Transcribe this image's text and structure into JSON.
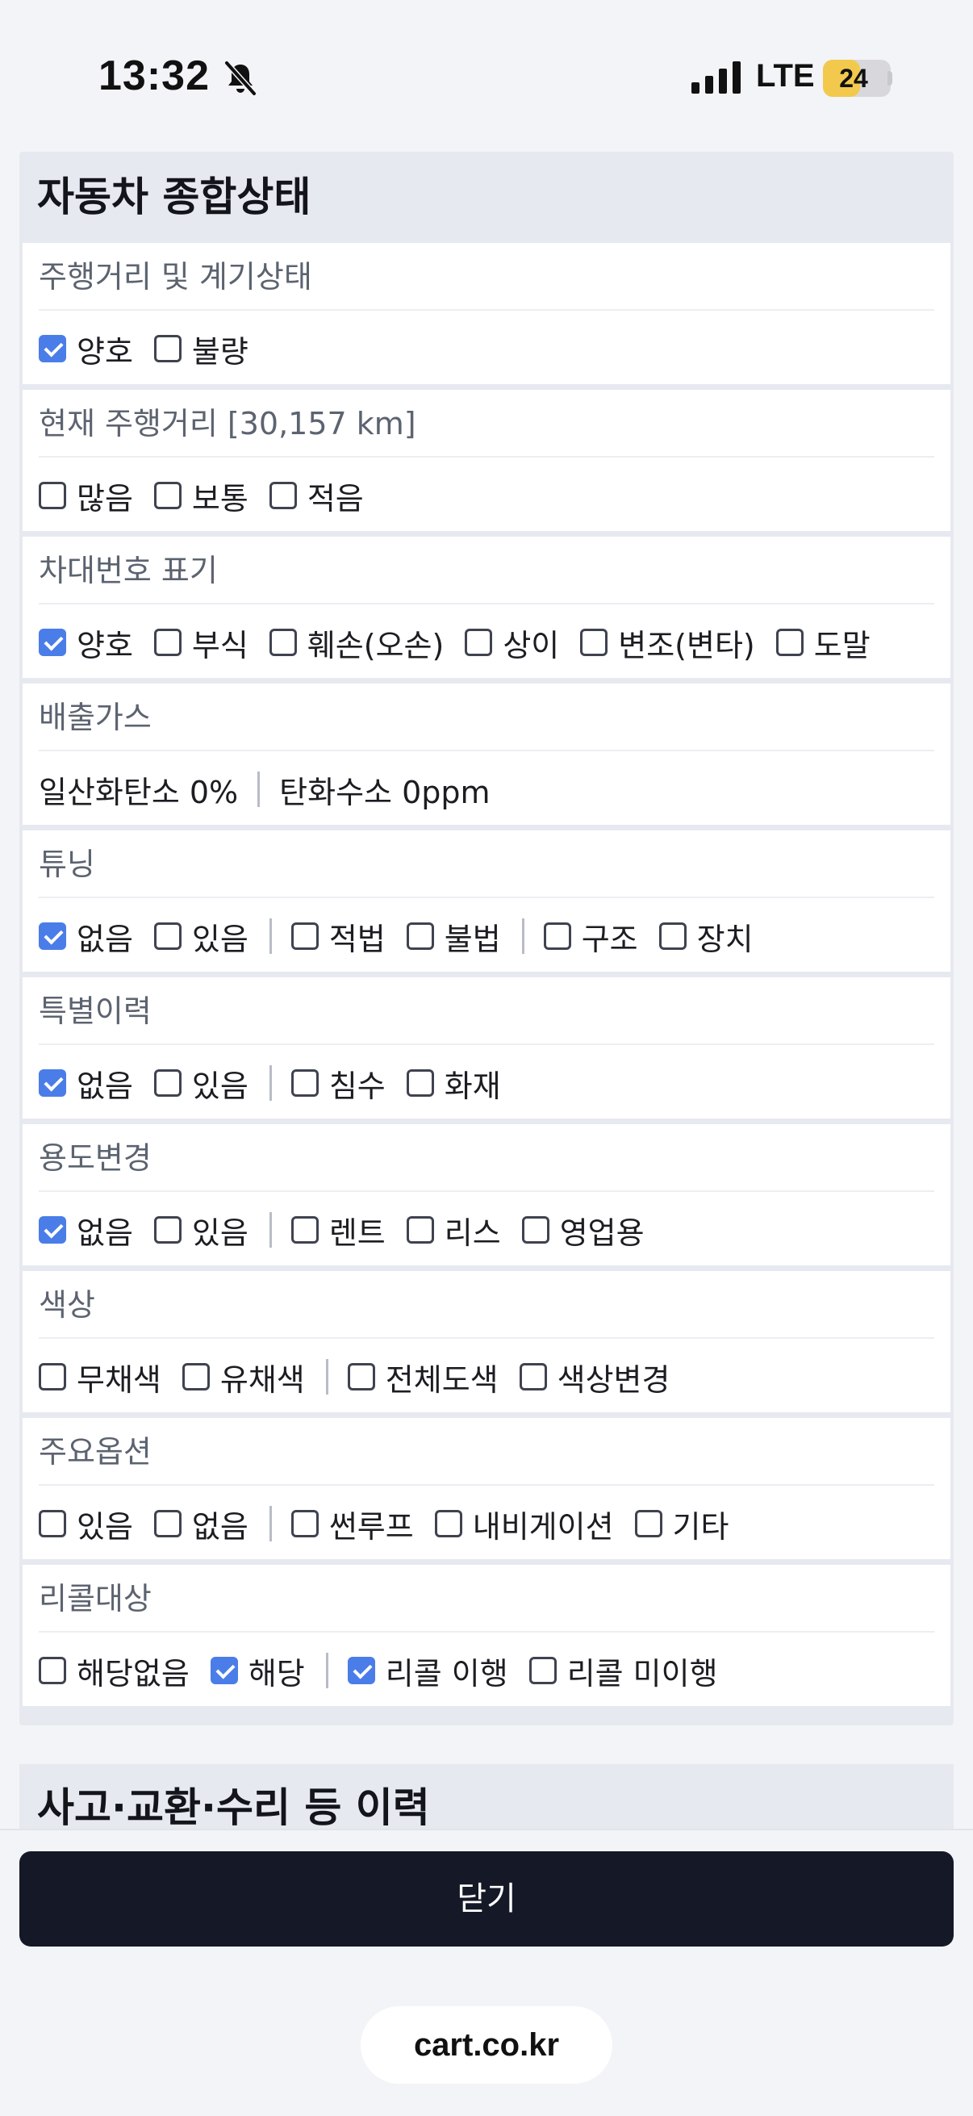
{
  "status_bar": {
    "time": "13:32",
    "network": "LTE",
    "battery": "24",
    "battery_level": 0.24,
    "icons": [
      "bell-muted-icon",
      "signal-icon",
      "battery-icon"
    ]
  },
  "card": {
    "title": "자동차 종합상태",
    "sections": [
      {
        "label": "주행거리 및 계기상태",
        "options": [
          {
            "label": "양호",
            "checked": true
          },
          {
            "label": "불량",
            "checked": false
          }
        ]
      },
      {
        "label": "현재 주행거리 [30,157 km]",
        "options": [
          {
            "label": "많음",
            "checked": false
          },
          {
            "label": "보통",
            "checked": false
          },
          {
            "label": "적음",
            "checked": false
          }
        ]
      },
      {
        "label": "차대번호 표기",
        "options": [
          {
            "label": "양호",
            "checked": true
          },
          {
            "label": "부식",
            "checked": false
          },
          {
            "label": "훼손(오손)",
            "checked": false
          },
          {
            "label": "상이",
            "checked": false
          },
          {
            "label": "변조(변타)",
            "checked": false
          },
          {
            "label": "도말",
            "checked": false
          }
        ]
      },
      {
        "label": "배출가스",
        "texts": [
          "일산화탄소 0%",
          "탄화수소 0ppm"
        ]
      },
      {
        "label": "튜닝",
        "groups": [
          [
            {
              "label": "없음",
              "checked": true
            },
            {
              "label": "있음",
              "checked": false
            }
          ],
          [
            {
              "label": "적법",
              "checked": false
            },
            {
              "label": "불법",
              "checked": false
            }
          ],
          [
            {
              "label": "구조",
              "checked": false
            },
            {
              "label": "장치",
              "checked": false
            }
          ]
        ]
      },
      {
        "label": "특별이력",
        "groups": [
          [
            {
              "label": "없음",
              "checked": true
            },
            {
              "label": "있음",
              "checked": false
            }
          ],
          [
            {
              "label": "침수",
              "checked": false
            },
            {
              "label": "화재",
              "checked": false
            }
          ]
        ]
      },
      {
        "label": "용도변경",
        "groups": [
          [
            {
              "label": "없음",
              "checked": true
            },
            {
              "label": "있음",
              "checked": false
            }
          ],
          [
            {
              "label": "렌트",
              "checked": false
            },
            {
              "label": "리스",
              "checked": false
            },
            {
              "label": "영업용",
              "checked": false
            }
          ]
        ]
      },
      {
        "label": "색상",
        "groups": [
          [
            {
              "label": "무채색",
              "checked": false
            },
            {
              "label": "유채색",
              "checked": false
            }
          ],
          [
            {
              "label": "전체도색",
              "checked": false
            },
            {
              "label": "색상변경",
              "checked": false
            }
          ]
        ]
      },
      {
        "label": "주요옵션",
        "groups": [
          [
            {
              "label": "있음",
              "checked": false
            },
            {
              "label": "없음",
              "checked": false
            }
          ],
          [
            {
              "label": "썬루프",
              "checked": false
            },
            {
              "label": "내비게이션",
              "checked": false
            },
            {
              "label": "기타",
              "checked": false
            }
          ]
        ]
      },
      {
        "label": "리콜대상",
        "groups": [
          [
            {
              "label": "해당없음",
              "checked": false
            },
            {
              "label": "해당",
              "checked": true
            }
          ],
          [
            {
              "label": "리콜 이행",
              "checked": true
            },
            {
              "label": "리콜 미이행",
              "checked": false
            }
          ]
        ]
      }
    ]
  },
  "card2": {
    "title": "사고·교환·수리 등 이력"
  },
  "footer": {
    "close_label": "닫기",
    "url": "cart.co.kr"
  },
  "colors": {
    "checkbox_checked": "#4a7de8",
    "button_dark": "#151826",
    "battery_yellow": "#f2c94c"
  }
}
